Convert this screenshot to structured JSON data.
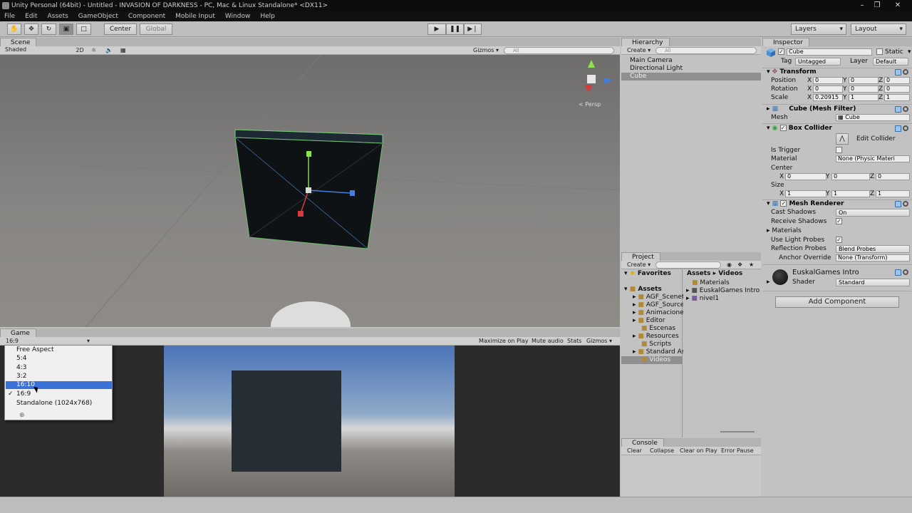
{
  "window": {
    "title": "Unity Personal (64bit) - Untitled - INVASION OF DARKNESS - PC, Mac & Linux Standalone* <DX11>"
  },
  "menu": [
    "File",
    "Edit",
    "Assets",
    "GameObject",
    "Component",
    "Mobile Input",
    "Window",
    "Help"
  ],
  "toolbar": {
    "center": "Center",
    "global": "Global",
    "layers": "Layers",
    "layout": "Layout"
  },
  "scene": {
    "tab": "Scene",
    "shading": "Shaded",
    "mode2d": "2D",
    "gizmos": "Gizmos",
    "search_placeholder": "All",
    "persp": "Persp"
  },
  "game": {
    "tab": "Game",
    "aspect": "16:9",
    "maximize": "Maximize on Play",
    "mute": "Mute audio",
    "stats": "Stats",
    "gizmos": "Gizmos"
  },
  "aspect_menu": {
    "items": [
      "Free Aspect",
      "5:4",
      "4:3",
      "3:2",
      "16:10",
      "16:9",
      "Standalone (1024x768)"
    ],
    "highlighted": "16:10",
    "checked": "16:9"
  },
  "hierarchy": {
    "tab": "Hierarchy",
    "create": "Create",
    "search_placeholder": "All",
    "items": [
      "Main Camera",
      "Directional Light",
      "Cube"
    ],
    "selected": "Cube"
  },
  "project": {
    "tab": "Project",
    "create": "Create",
    "favorites": "Favorites",
    "assets": "Assets",
    "breadcrumb": [
      "Assets",
      "Videos"
    ],
    "folders": [
      "AGF_Scenet",
      "AGF_Source",
      "Animaciones",
      "Editor",
      "Escenas",
      "Resources",
      "Scripts",
      "Standard As",
      "Videos"
    ],
    "selected_folder": "Videos",
    "files": [
      "Materials",
      "EuskalGames Intro",
      "nivel1"
    ]
  },
  "console": {
    "tab": "Console",
    "clear": "Clear",
    "collapse": "Collapse",
    "clear_on_play": "Clear on Play",
    "error_pause": "Error Pause"
  },
  "inspector": {
    "tab": "Inspector",
    "name": "Cube",
    "static": "Static",
    "tag_label": "Tag",
    "tag": "Untagged",
    "layer_label": "Layer",
    "layer": "Default",
    "transform": {
      "title": "Transform",
      "position_label": "Position",
      "rotation_label": "Rotation",
      "scale_label": "Scale",
      "position": [
        "0",
        "0",
        "0"
      ],
      "rotation": [
        "0",
        "0",
        "0"
      ],
      "scale": [
        "0.20915",
        "1",
        "1"
      ]
    },
    "mesh_filter": {
      "title": "Cube (Mesh Filter)",
      "mesh_label": "Mesh",
      "mesh": "Cube"
    },
    "box_collider": {
      "title": "Box Collider",
      "edit": "Edit Collider",
      "trigger_label": "Is Trigger",
      "material_label": "Material",
      "material": "None (Physic Materi",
      "center_label": "Center",
      "center": [
        "0",
        "0",
        "0"
      ],
      "size_label": "Size",
      "size": [
        "1",
        "1",
        "1"
      ]
    },
    "mesh_renderer": {
      "title": "Mesh Renderer",
      "cast_label": "Cast Shadows",
      "cast": "On",
      "receive_label": "Receive Shadows",
      "materials_label": "Materials",
      "light_probes_label": "Use Light Probes",
      "reflection_label": "Reflection Probes",
      "reflection": "Blend Probes",
      "anchor_label": "Anchor Override",
      "anchor": "None (Transform)"
    },
    "material": {
      "name": "EuskalGames Intro",
      "shader_label": "Shader",
      "shader": "Standard"
    },
    "add_component": "Add Component"
  },
  "axis_labels": {
    "x": "X",
    "y": "Y",
    "z": "Z"
  }
}
